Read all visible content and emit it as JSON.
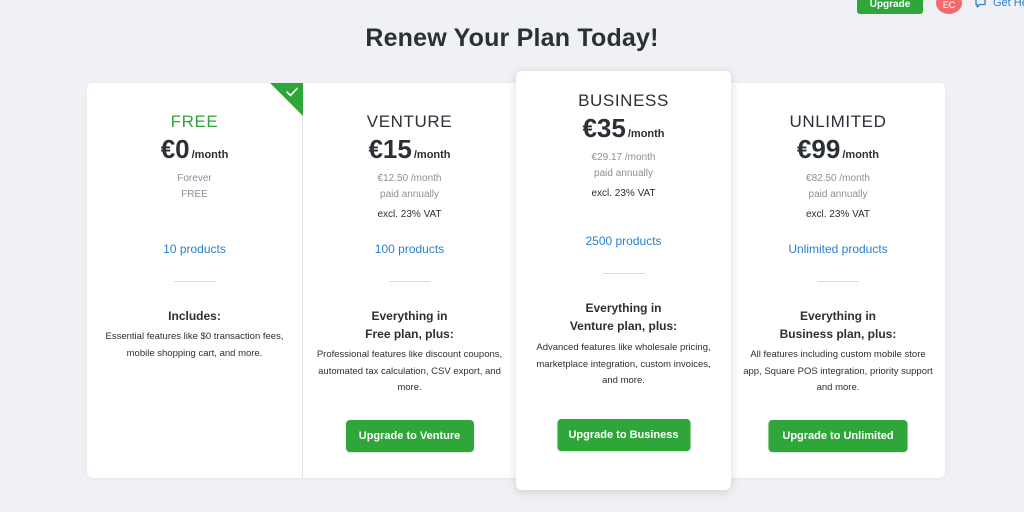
{
  "topbar": {
    "upgrade_label": "Upgrade",
    "avatar_initials": "EC",
    "help_label": "Get Help"
  },
  "heading": "Renew Your Plan Today!",
  "colors": {
    "accent_green": "#2fa63a",
    "link_blue": "#2a7fd4"
  },
  "plans": [
    {
      "name": "FREE",
      "price": "€0",
      "per": "/month",
      "sub1": "Forever",
      "sub2": "FREE",
      "products": "10 products",
      "includes_line1": "Includes:",
      "desc": "Essential features like $0 transaction fees, mobile shopping cart, and more.",
      "current": true,
      "check_icon": "checkmark-icon"
    },
    {
      "name": "VENTURE",
      "price": "€15",
      "per": "/month",
      "sub1": "€12.50 /month",
      "sub2": "paid annually",
      "vat": "excl. 23% VAT",
      "products": "100 products",
      "includes_line1": "Everything in",
      "includes_line2": "Free plan, plus:",
      "desc": "Professional features like discount coupons, automated tax calculation, CSV export, and more.",
      "cta": "Upgrade to Venture"
    },
    {
      "name": "BUSINESS",
      "price": "€35",
      "per": "/month",
      "sub1": "€29.17 /month",
      "sub2": "paid annually",
      "vat": "excl. 23% VAT",
      "products": "2500 products",
      "includes_line1": "Everything in",
      "includes_line2": "Venture plan, plus:",
      "desc": "Advanced features like wholesale pricing, marketplace integration, custom invoices, and more.",
      "cta": "Upgrade to Business"
    },
    {
      "name": "UNLIMITED",
      "price": "€99",
      "per": "/month",
      "sub1": "€82.50 /month",
      "sub2": "paid annually",
      "vat": "excl. 23% VAT",
      "products": "Unlimited products",
      "includes_line1": "Everything in",
      "includes_line2": "Business plan, plus:",
      "desc": "All features including custom mobile store app, Square POS integration, priority support and more.",
      "cta": "Upgrade to Unlimited"
    }
  ]
}
